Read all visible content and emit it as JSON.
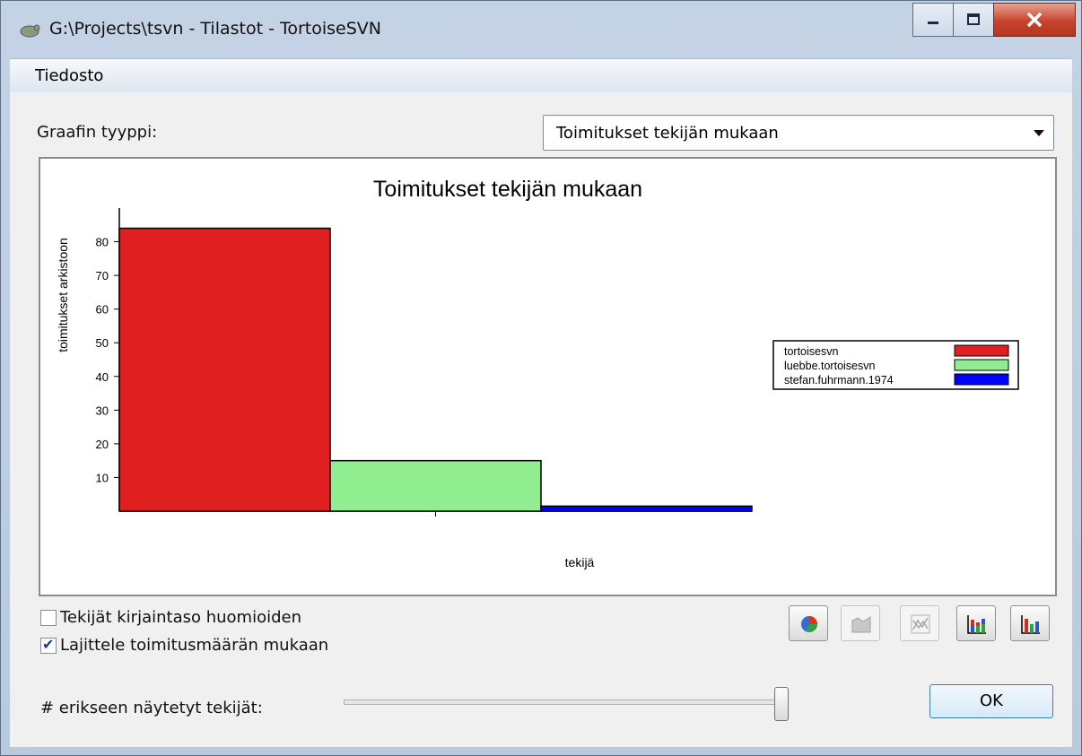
{
  "window": {
    "title": "G:\\Projects\\tsvn - Tilastot - TortoiseSVN",
    "controls": {
      "minimize": "minimize",
      "maximize": "maximize",
      "close": "close"
    }
  },
  "menu": {
    "items": [
      {
        "label": "Tiedosto"
      }
    ]
  },
  "graph_type": {
    "label": "Graafin tyyppi:",
    "selected": "Toimitukset tekijän mukaan"
  },
  "chart_data": {
    "type": "bar",
    "title": "Toimitukset tekijän mukaan",
    "xlabel": "tekijä",
    "ylabel": "toimitukset arkistoon",
    "ylim": [
      0,
      90
    ],
    "yticks": [
      10,
      20,
      30,
      40,
      50,
      60,
      70,
      80
    ],
    "series": [
      {
        "name": "tortoisesvn",
        "value": 84,
        "color": "#e02020"
      },
      {
        "name": "luebbe.tortoisesvn",
        "value": 15,
        "color": "#90ee90"
      },
      {
        "name": "stefan.fuhrmann.1974",
        "value": 1.5,
        "color": "#0000ff"
      }
    ],
    "legend_position": "right",
    "grid": false
  },
  "options": {
    "case_sensitive": {
      "label": "Tekijät kirjaintaso huomioiden",
      "checked": false
    },
    "sort_by_commits": {
      "label": "Lajittele toimitusmäärän mukaan",
      "checked": true
    }
  },
  "toolbar": {
    "buttons": [
      {
        "name": "pie-chart-button",
        "icon": "pie-chart-icon",
        "enabled": true
      },
      {
        "name": "area-chart-button",
        "icon": "area-chart-icon",
        "enabled": false
      },
      {
        "name": "line-chart-button",
        "icon": "line-chart-icon",
        "enabled": false
      },
      {
        "name": "stacked-bar-button",
        "icon": "stacked-bar-icon",
        "enabled": true
      },
      {
        "name": "bar-chart-button",
        "icon": "bar-chart-icon",
        "enabled": true
      }
    ]
  },
  "authors_slider": {
    "label": "# erikseen näytetyt tekijät:",
    "value_fraction": 1.0
  },
  "ok_button": {
    "label": "OK"
  }
}
